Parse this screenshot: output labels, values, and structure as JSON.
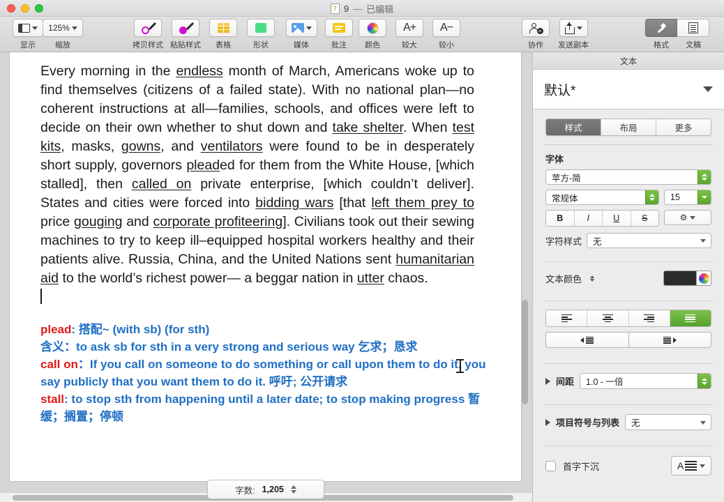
{
  "window": {
    "title_number": "9",
    "title_sep": "—",
    "title_status": "已编辑",
    "doc_badge": "7"
  },
  "toolbar": {
    "items": [
      {
        "label": "显示",
        "icon": "display-icon",
        "has_chevron": true
      },
      {
        "label": "缩放",
        "icon": "zoom-value",
        "value": "125%",
        "has_chevron": true
      },
      {
        "label": "拷贝样式",
        "icon": "eyedropper-icon"
      },
      {
        "label": "粘贴样式",
        "icon": "eyedropper-fill-icon"
      },
      {
        "label": "表格",
        "icon": "table-icon"
      },
      {
        "label": "形状",
        "icon": "shape-icon"
      },
      {
        "label": "媒体",
        "icon": "media-icon",
        "has_chevron": true
      },
      {
        "label": "批注",
        "icon": "comment-icon"
      },
      {
        "label": "颜色",
        "icon": "color-wheel-icon"
      },
      {
        "label": "较大",
        "icon": "font-bigger-icon",
        "glyph": "A+"
      },
      {
        "label": "较小",
        "icon": "font-smaller-icon",
        "glyph": "A−"
      },
      {
        "label": "协作",
        "icon": "collaborate-icon"
      },
      {
        "label": "发送副本",
        "icon": "share-icon",
        "has_chevron": true
      }
    ],
    "view_toggle": {
      "format_label": "格式",
      "document_label": "文稿",
      "active": "格式"
    }
  },
  "document": {
    "paragraphs": [
      "Every morning in the <u>endless</u> month of March, Americans woke up to find themselves (citizens of a failed state). With no national plan—no coherent instructions at all—families, schools, and offices were left to decide on their own whether to shut down and <u>take shelter</u>. When <u>test kits</u>, masks, <u>gowns</u>, and <u>ventilators</u> were found to be in desperately short supply, governors <u>plead</u>ed for them from the White House, [which stalled], then <u>called on</u> private enterprise, [which couldn&rsquo;t deliver]. States and cities were forced into <u>bidding wars</u> [that <u>left them prey to</u> price <u>gouging</u> and <u>corporate profiteering</u>]. Civilians took out their sewing machines to try to keep ill&ndash;equipped hospital workers healthy and their patients alive. Russia, China, and the United Nations sent <u>humanitarian aid</u> to the world&rsquo;s richest power&mdash; a beggar nation in <u>utter</u> chaos."
    ],
    "notes": [
      "<span class=\"kw\">plead</span>: 搭配~ (with sb) (for sth)",
      "含义：to ask sb for sth in a very strong and serious way 乞求；恳求",
      "<span class=\"kw\">call on</span>：If you call on someone to do something or call upon them to do it, you say publicly that you want them to do it. 呼吁; 公开请求",
      "<span class=\"kw\">stall</span>: to stop sth from happening until a later date; to stop making progress 暂缓；搁置；停顿"
    ]
  },
  "status_bar": {
    "word_count_label": "字数:",
    "word_count_value": "1,205"
  },
  "inspector": {
    "header": "文本",
    "style_name": "默认*",
    "tabs": [
      {
        "label": "样式",
        "active": true
      },
      {
        "label": "布局",
        "active": false
      },
      {
        "label": "更多",
        "active": false
      }
    ],
    "font_section": {
      "title": "字体",
      "family": "苹方-简",
      "weight": "常规体",
      "size": "15",
      "bold": "B",
      "italic": "I",
      "underline": "U",
      "strikethrough": "S",
      "gear": "⚙"
    },
    "character_style": {
      "label": "字符样式",
      "value": "无"
    },
    "text_color": {
      "label": "文本颜色",
      "swatch": "#2b2b2b"
    },
    "alignment": {
      "options": [
        "align-left",
        "align-center",
        "align-right",
        "align-justify"
      ],
      "active_index": 3,
      "accent": "#5fa82e"
    },
    "indent": {
      "decrease": "decrease-indent",
      "increase": "increase-indent"
    },
    "spacing": {
      "label": "间距",
      "value": "1.0 - 一倍"
    },
    "bullets": {
      "label": "项目符号与列表",
      "value": "无"
    },
    "drop_cap": {
      "label": "首字下沉",
      "checked": false
    }
  }
}
